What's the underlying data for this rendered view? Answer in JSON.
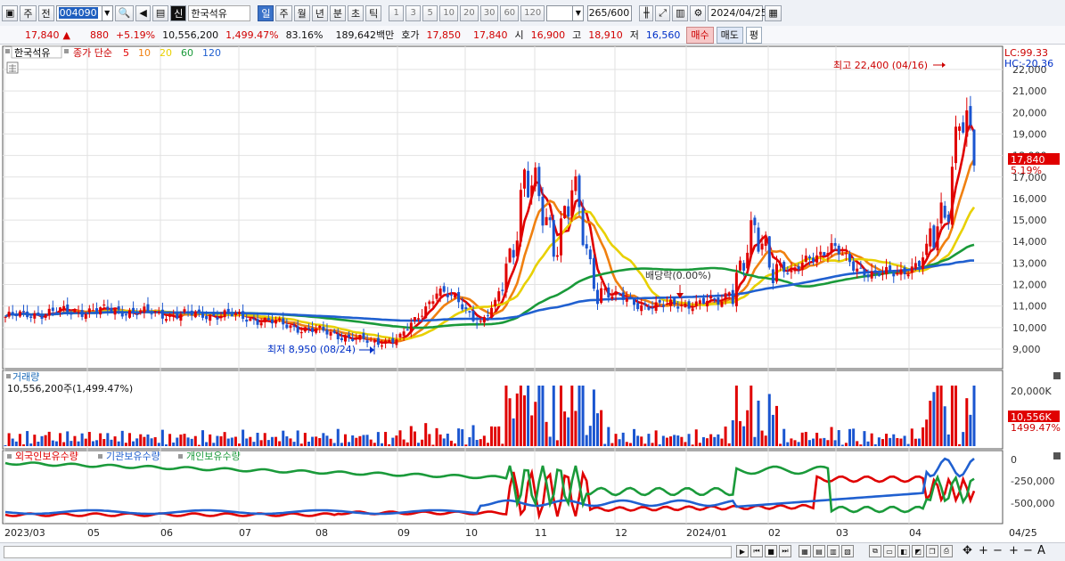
{
  "toolbar": {
    "type_label": "주",
    "prev_label": "전",
    "stock_code": "004090",
    "market_badge": "신",
    "stock_name": "한국석유",
    "periods": [
      "일",
      "주",
      "월",
      "년",
      "분",
      "초",
      "틱"
    ],
    "active_period": "일",
    "intervals": [
      "1",
      "3",
      "5",
      "10",
      "20",
      "30",
      "60",
      "120"
    ],
    "bar_count": "265",
    "bar_total": "/600",
    "date": "2024/04/25"
  },
  "price_bar": {
    "price": "17,840",
    "change_arrow": "▲",
    "change": "880",
    "change_rate": "+5.19%",
    "volume": "10,556,200",
    "volume_rate": "1,499.47%",
    "ratio": "83.16%",
    "amount": "189,642백만",
    "quote_label": "호가",
    "ask": "17,850",
    "bid": "17,840",
    "open_label": "시",
    "open": "16,900",
    "high_label": "고",
    "high": "18,910",
    "low_label": "저",
    "low": "16,560",
    "buy_label": "매수",
    "sell_label": "매도",
    "flat_label": "평"
  },
  "legend": {
    "stock": "한국석유",
    "ma_prefix": "종가 단순",
    "ma": [
      {
        "label": "5",
        "color": "#e00000"
      },
      {
        "label": "10",
        "color": "#f08010"
      },
      {
        "label": "20",
        "color": "#e8d000"
      },
      {
        "label": "60",
        "color": "#1a9a3a"
      },
      {
        "label": "120",
        "color": "#2060d0"
      }
    ]
  },
  "annotations": {
    "high": "최고 22,400 (04/16)",
    "low": "최저 8,950 (08/24)",
    "dividend": "배당락(0.00%)",
    "lc": "LC:99.33",
    "hc": "HC:-20.36",
    "price_tag": "17,840",
    "rate_tag": "5.19%"
  },
  "volume_panel": {
    "title": "거래량",
    "value": "10,556,200주(1,499.47%)",
    "tag": "10,556K",
    "tag_rate": "1499.47%",
    "scale": "20,000K"
  },
  "holding_panel": {
    "items": [
      {
        "label": "외국인보유수량",
        "color": "#e00000"
      },
      {
        "label": "기관보유수량",
        "color": "#2060d0"
      },
      {
        "label": "개인보유수량",
        "color": "#1a9a3a"
      }
    ],
    "scale": [
      "0",
      "-250,000",
      "-500,000"
    ]
  },
  "x_labels": [
    "2023/03",
    "05",
    "06",
    "07",
    "08",
    "09",
    "10",
    "11",
    "12",
    "2024/01",
    "02",
    "03",
    "04",
    "04/25"
  ],
  "chart_data": {
    "type": "candlestick",
    "price_axis": [
      "22,000",
      "21,000",
      "20,000",
      "19,000",
      "18,000",
      "17,000",
      "16,000",
      "15,000",
      "14,000",
      "13,000",
      "12,000",
      "11,000",
      "10,000",
      "9,000"
    ],
    "ylim": [
      8400,
      22500
    ],
    "months": [
      "2023/03",
      "05",
      "06",
      "07",
      "08",
      "09",
      "10",
      "11",
      "12",
      "2024/01",
      "02",
      "03",
      "04"
    ],
    "close_anchors": [
      [
        0,
        10500
      ],
      [
        15,
        10750
      ],
      [
        30,
        10800
      ],
      [
        45,
        10600
      ],
      [
        60,
        10600
      ],
      [
        70,
        10350
      ],
      [
        80,
        10000
      ],
      [
        90,
        9700
      ],
      [
        100,
        9300
      ],
      [
        108,
        9500
      ],
      [
        112,
        10300
      ],
      [
        118,
        11700
      ],
      [
        124,
        11200
      ],
      [
        130,
        10200
      ],
      [
        134,
        11000
      ],
      [
        138,
        13500
      ],
      [
        142,
        17000
      ],
      [
        146,
        15500
      ],
      [
        150,
        14200
      ],
      [
        155,
        16400
      ],
      [
        160,
        12500
      ],
      [
        165,
        11600
      ],
      [
        172,
        11100
      ],
      [
        180,
        11000
      ],
      [
        190,
        11150
      ],
      [
        196,
        11200
      ],
      [
        200,
        12500
      ],
      [
        205,
        14000
      ],
      [
        210,
        13300
      ],
      [
        215,
        12400
      ],
      [
        220,
        13300
      ],
      [
        226,
        13700
      ],
      [
        232,
        12900
      ],
      [
        238,
        12400
      ],
      [
        244,
        12600
      ],
      [
        250,
        12900
      ],
      [
        254,
        14200
      ],
      [
        258,
        16500
      ],
      [
        261,
        20000
      ],
      [
        263,
        18500
      ],
      [
        265,
        17840
      ]
    ],
    "volume_axis": [
      "20,000K"
    ],
    "holding_axis": [
      "0",
      "-250,000",
      "-500,000"
    ]
  }
}
